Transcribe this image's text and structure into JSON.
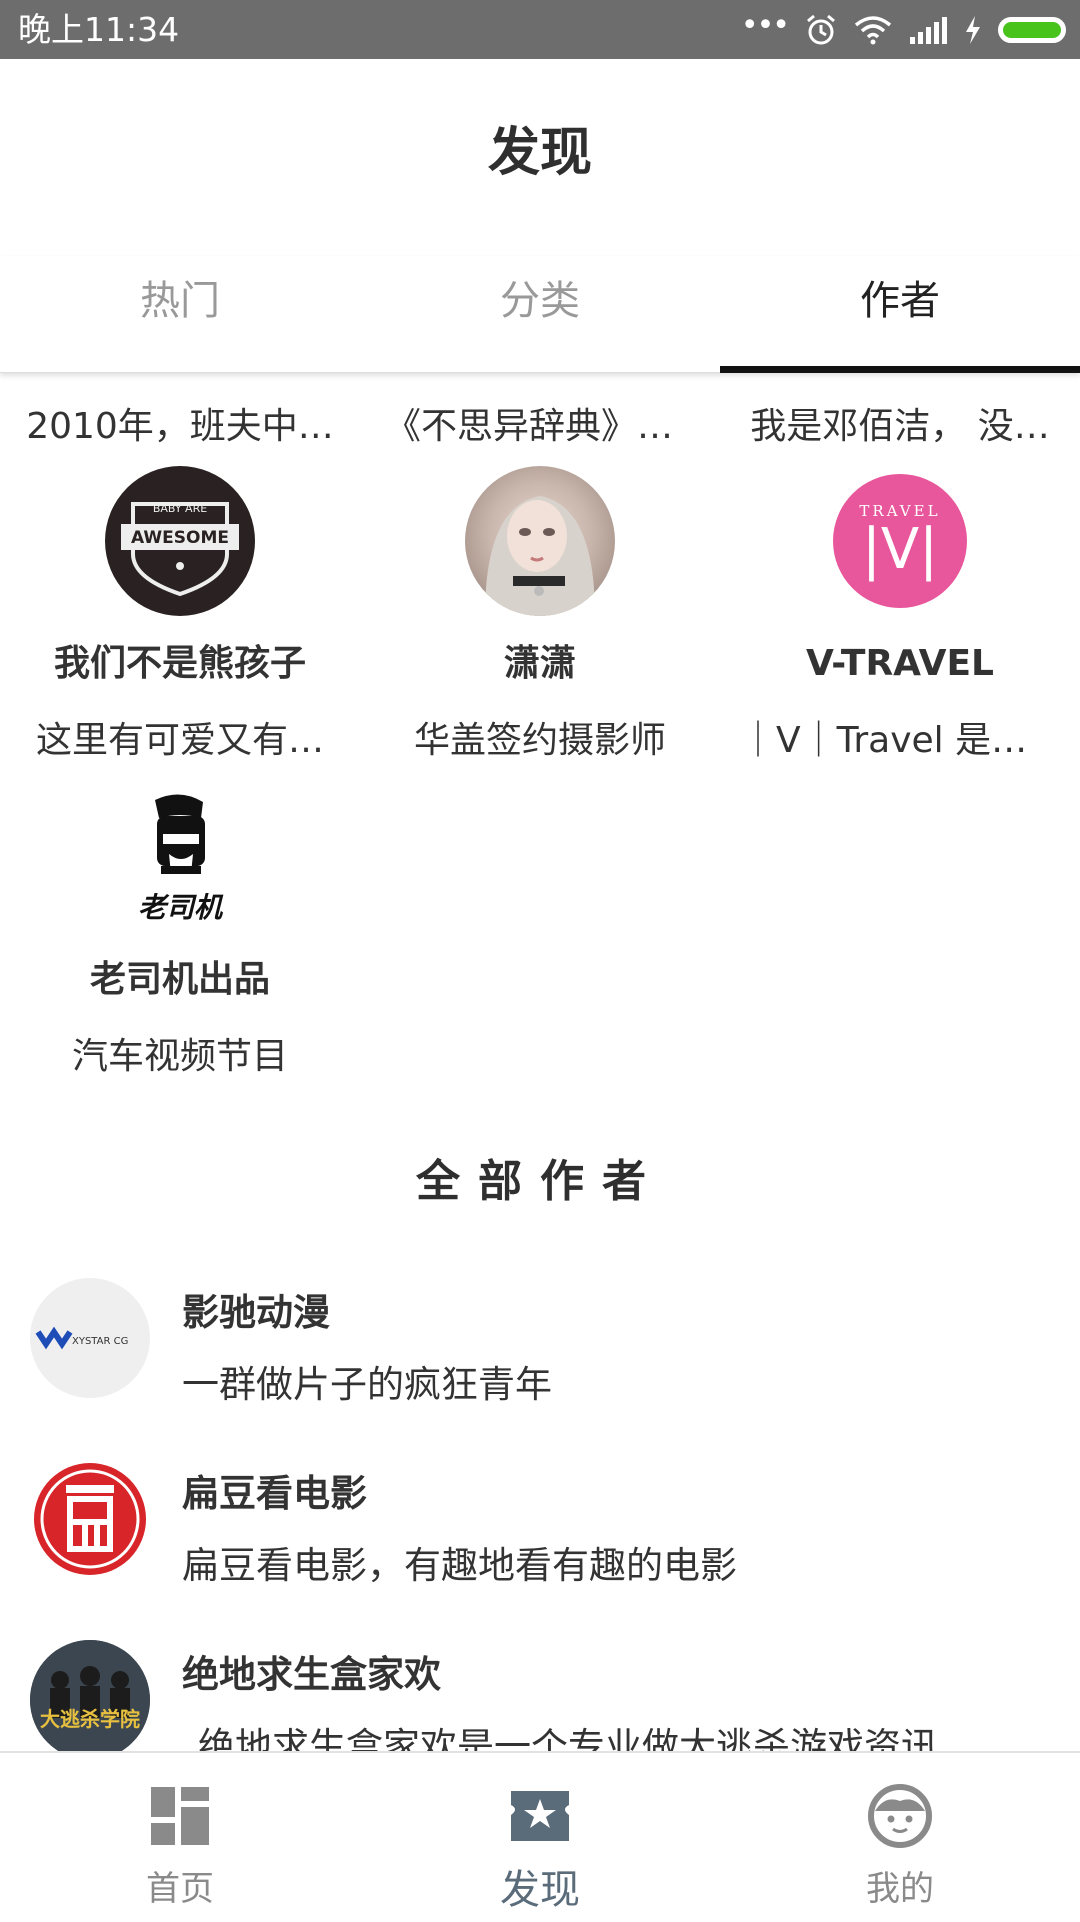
{
  "status_bar": {
    "time": "晚上11:34",
    "dots": "•••"
  },
  "header": {
    "title": "发现"
  },
  "tabs": [
    {
      "label": "热门",
      "active": false
    },
    {
      "label": "分类",
      "active": false
    },
    {
      "label": "作者",
      "active": true
    }
  ],
  "featured": {
    "top_descriptions": [
      "2010年，班夫中…",
      "《不思异辞典》记…",
      "我是邓佰洁， 没…"
    ],
    "authors": [
      {
        "name": "我们不是熊孩子",
        "desc": "这里有可爱又有…",
        "avatar_text_top": "BABY ARE",
        "avatar_text": "AWESOME"
      },
      {
        "name": "潇潇",
        "desc": "华盖签约摄影师"
      },
      {
        "name": "V-TRAVEL",
        "desc": "｜V｜Travel 是赞…",
        "avatar_text_top": "TRAVEL",
        "avatar_text": "V"
      },
      {
        "name": "老司机出品",
        "desc": "汽车视频节目",
        "avatar_text": "老司机"
      }
    ]
  },
  "section_title": "全部作者",
  "all_authors": [
    {
      "name": "影驰动漫",
      "desc": "一群做片子的疯狂青年",
      "avatar_text": "XYSTAR CG"
    },
    {
      "name": "扁豆看电影",
      "desc": "扁豆看电影，有趣地看有趣的电影"
    },
    {
      "name": "绝地求生盒家欢",
      "desc": "绝地求生盒家欢是一个专业做大逃杀游戏资讯、…",
      "avatar_text": "大逃杀学院"
    }
  ],
  "bottom_nav": [
    {
      "label": "首页",
      "active": false
    },
    {
      "label": "发现",
      "active": true
    },
    {
      "label": "我的",
      "active": false
    }
  ]
}
